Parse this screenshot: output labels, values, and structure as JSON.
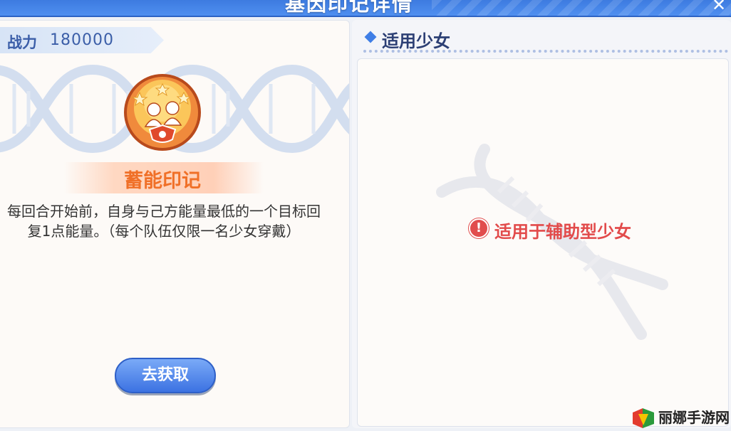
{
  "header": {
    "title": "基因印记详情",
    "close_icon": "close-icon"
  },
  "mark": {
    "power_label": "战力",
    "power_value": "180000",
    "name": "蓄能印记",
    "description": "每回合开始前，自身与己方能量最低的一个目标回复1点能量。（每个队伍仅限一名少女穿戴）",
    "acquire_button": "去获取",
    "emblem_icon": "twin-figures-emblem-icon"
  },
  "applicable": {
    "section_title": "适用少女",
    "notice": "适用于辅助型少女",
    "notice_icon": "warning-icon"
  },
  "watermark": {
    "brand": "丽娜手游网"
  },
  "colors": {
    "banner": "#3d7be0",
    "accent_orange": "#f07028",
    "warning_red": "#e24b4b",
    "button_blue": "#3c72e2"
  }
}
